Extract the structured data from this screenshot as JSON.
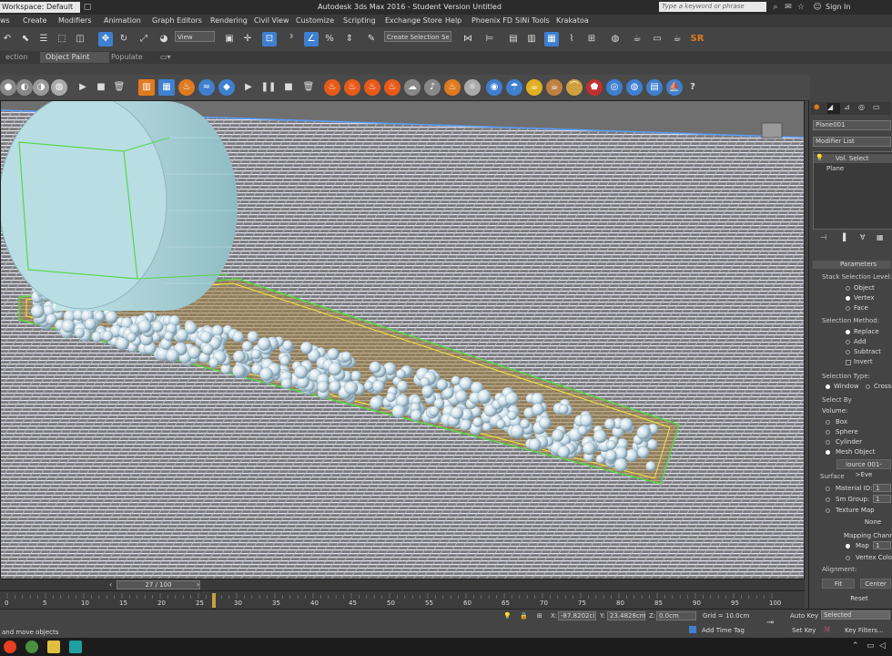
{
  "titlebar": {
    "workspace": "Workspace: Default",
    "title": "Autodesk 3ds Max 2016 - Student Version    Untitled",
    "search_placeholder": "Type a keyword or phrase",
    "sign_in": "Sign In"
  },
  "menubar": {
    "items": [
      "ws",
      "Create",
      "Modifiers",
      "Animation",
      "Graph Editors",
      "Rendering",
      "Civil View",
      "Customize",
      "Scripting",
      "Exchange Store",
      "Help",
      "Phoenix FD",
      "SiNi Tools",
      "Krakatoa"
    ]
  },
  "toolbar": {
    "view_dropdown": "View",
    "selection_set": "Create Selection Se"
  },
  "ribbon": {
    "tabs": [
      "ection",
      "Object Paint",
      "Populate"
    ]
  },
  "command_panel": {
    "object_name": "Plane001",
    "modifier_list": "Modifier List",
    "stack": [
      "Vol. Select",
      "Plane"
    ],
    "parameters_title": "Parameters",
    "stack_selection_level": {
      "label": "Stack Selection Level:",
      "options": [
        "Object",
        "Vertex",
        "Face"
      ],
      "selected": "Vertex"
    },
    "selection_method": {
      "label": "Selection Method:",
      "options": [
        "Replace",
        "Add",
        "Subtract"
      ],
      "selected": "Replace",
      "invert": "Invert"
    },
    "selection_type": {
      "label": "Selection Type:",
      "options": [
        "Window",
        "Crossi"
      ],
      "selected": "Window"
    },
    "select_by": {
      "label": "Select By",
      "volume_label": "Volume:",
      "options": [
        "Box",
        "Sphere",
        "Cylinder",
        "Mesh Object"
      ],
      "selected": "Mesh Object",
      "mesh_source": "iource 001->Eve"
    },
    "surface": {
      "label": "Surface",
      "material_id_label": "Material ID:",
      "material_id": "1",
      "sm_group_label": "Sm Group:",
      "sm_group": "1",
      "texture_map": "Texture Map",
      "none_button": "None"
    },
    "mapping": {
      "label": "Mapping Channe",
      "map_label": "Map",
      "map_value": "1",
      "vertex_color": "Vertex Color"
    },
    "alignment": {
      "label": "Alignment:",
      "fit": "Fit",
      "center": "Center",
      "reset": "Reset"
    }
  },
  "timeline": {
    "frame_display": "27 / 100",
    "current_frame": 27,
    "total_frames": 100,
    "ticks": [
      "0",
      "5",
      "10",
      "15",
      "20",
      "25",
      "30",
      "35",
      "40",
      "45",
      "50",
      "55",
      "60",
      "65",
      "70",
      "75",
      "80",
      "85",
      "90",
      "95",
      "100"
    ]
  },
  "statusbar": {
    "prompt": "and move objects",
    "x_label": "X:",
    "x": "-87.8202ci",
    "y_label": "Y:",
    "y": "23.4828cm",
    "z_label": "Z:",
    "z": "0.0cm",
    "grid": "Grid = 10.0cm",
    "add_time_tag": "Add Time Tag",
    "auto_key": "Auto Key",
    "selected": "Selected",
    "set_key": "Set Key",
    "key_filters": "Key Filters..."
  },
  "colors": {
    "accent_blue": "#3f7fd0",
    "viewport_bg": "#6f6f6f",
    "wire_yellow": "#f2e53a",
    "wire_green": "#57d64a",
    "cylinder": "#b6dde2"
  }
}
